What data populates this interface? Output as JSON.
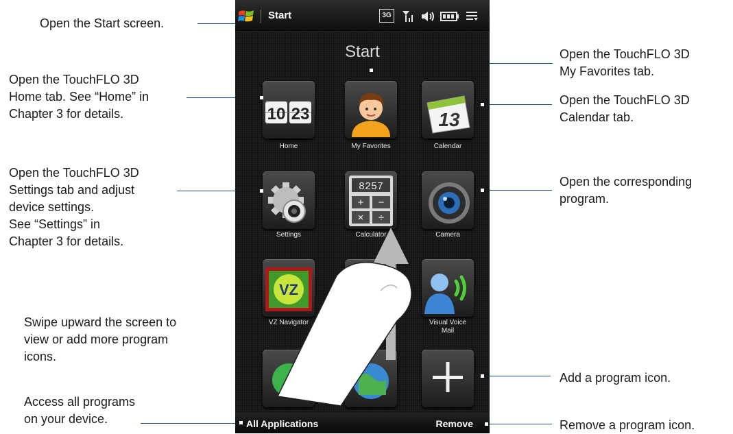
{
  "annotations": {
    "start_screen": "Open the Start screen.",
    "home_tab": "Open the TouchFLO 3D\nHome tab. See “Home” in\nChapter 3 for details.",
    "settings_tab": "Open the TouchFLO 3D\nSettings tab and adjust\ndevice settings.\nSee “Settings” in\nChapter 3 for details.",
    "swipe": "Swipe upward the screen to\nview or add more program\nicons.",
    "all_programs": "Access all programs\non your device.",
    "favorites_tab": "Open the TouchFLO 3D\nMy Favorites tab.",
    "calendar_tab": "Open the TouchFLO 3D\nCalendar tab.",
    "corresponding_program": "Open the corresponding\nprogram.",
    "add_icon": "Add a program icon.",
    "remove_icon": "Remove a program icon."
  },
  "status_bar": {
    "title": "Start",
    "icons": [
      "3g-icon",
      "signal-icon",
      "speaker-icon",
      "battery-icon",
      "menu-icon"
    ],
    "network_label": "3G"
  },
  "start_screen": {
    "heading": "Start",
    "tiles": [
      {
        "label": "Home",
        "icon": "clock-icon",
        "clock_digits": "10 23"
      },
      {
        "label": "My Favorites",
        "icon": "person-icon"
      },
      {
        "label": "Calendar",
        "icon": "calendar-icon",
        "day": "13"
      },
      {
        "label": "Settings",
        "icon": "gear-icon"
      },
      {
        "label": "Calculator",
        "icon": "calculator-icon",
        "display": "8257",
        "keys": [
          "+",
          "−",
          "×",
          "÷"
        ]
      },
      {
        "label": "Camera",
        "icon": "camera-icon"
      },
      {
        "label": "VZ Navigator",
        "icon": "vz-navigator-icon",
        "logo": "VZ"
      },
      {
        "label": "",
        "icon": "opera-icon"
      },
      {
        "label": "Visual Voice Mail",
        "icon": "voicemail-icon"
      },
      {
        "label": "",
        "icon": "phone-icon"
      },
      {
        "label": "",
        "icon": "globe-icon"
      },
      {
        "label": "",
        "icon": "add-icon",
        "symbol": "+"
      }
    ]
  },
  "bottom_bar": {
    "left": "All Applications",
    "right": "Remove"
  }
}
